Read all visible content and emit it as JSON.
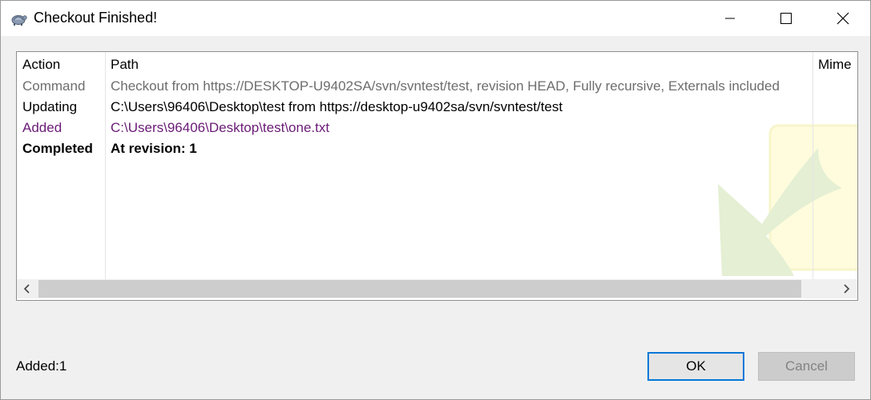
{
  "window": {
    "title": "Checkout Finished!"
  },
  "list": {
    "columns": {
      "action": "Action",
      "path": "Path",
      "mime": "Mime"
    },
    "rows": [
      {
        "action": "Command",
        "path": "Checkout from https://DESKTOP-U9402SA/svn/svntest/test, revision HEAD, Fully recursive, Externals included"
      },
      {
        "action": "Updating",
        "path": "C:\\Users\\96406\\Desktop\\test from https://desktop-u9402sa/svn/svntest/test"
      },
      {
        "action": "Added",
        "path": "C:\\Users\\96406\\Desktop\\test\\one.txt"
      },
      {
        "action": "Completed",
        "path": "At revision: 1"
      }
    ]
  },
  "status": {
    "text": "Added:1"
  },
  "buttons": {
    "ok": "OK",
    "cancel": "Cancel"
  },
  "colors": {
    "command": "#6d6d6d",
    "added": "#6a1b76",
    "accent": "#0078d7"
  },
  "icons": {
    "app": "tortoise-icon",
    "minimize": "minimize-icon",
    "maximize": "maximize-icon",
    "close": "close-icon"
  }
}
